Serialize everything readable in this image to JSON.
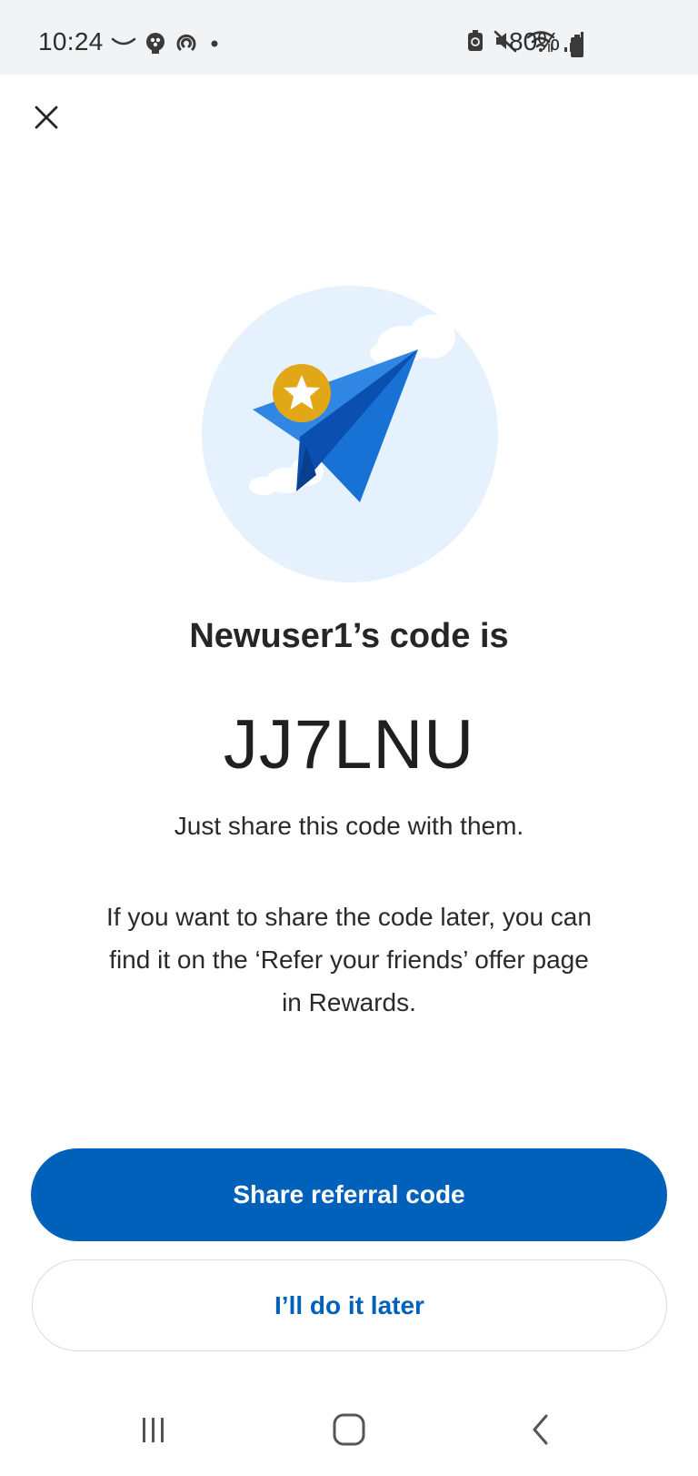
{
  "status_bar": {
    "time": "10:24",
    "battery_text": "80%",
    "icons_left": [
      "call-icon",
      "people-icon",
      "sync-icon",
      "dot-icon"
    ],
    "icons_right": [
      "battery-saver-icon",
      "mute-icon",
      "wifi-icon",
      "signal-icon",
      "battery-icon"
    ]
  },
  "header": {
    "close_icon": "close-icon"
  },
  "illustration": {
    "name": "paper-plane-star-illustration",
    "colors": {
      "circle_bg": "#e5f2fd",
      "plane_light": "#2f86e3",
      "plane_dark": "#0b4fb0",
      "star_badge": "#e2a717"
    }
  },
  "content": {
    "headline": "Newuser1’s code is",
    "code": "JJ7LNU",
    "subtext": "Just share this code with them.",
    "info_line1": "If you want to share the code later, you can",
    "info_line2": "find it on the ‘Refer your friends’ offer page",
    "info_line3": "in Rewards."
  },
  "actions": {
    "primary_label": "Share referral code",
    "secondary_label": "I’ll do it later"
  },
  "colors": {
    "accent": "#0061bb",
    "status_bar_bg": "#f2f3f4"
  },
  "nav_bar": {
    "items": [
      "recent-apps-icon",
      "home-icon",
      "back-icon"
    ]
  }
}
